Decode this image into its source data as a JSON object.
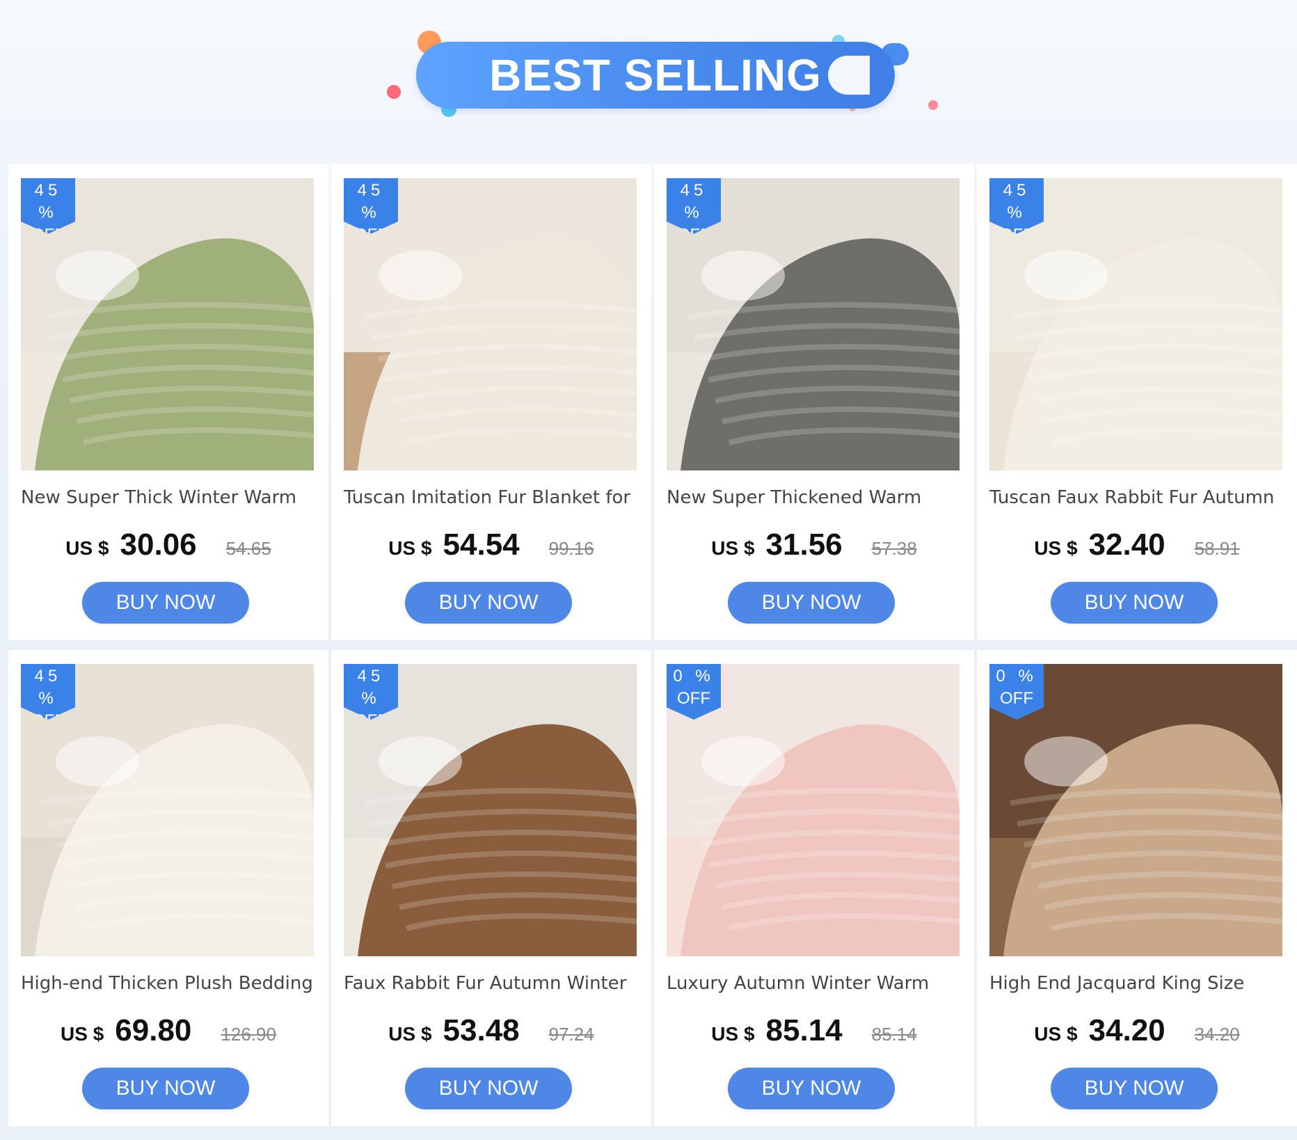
{
  "banner": {
    "title": "BEST SELLING"
  },
  "products": [
    {
      "title": "New Super Thick Winter Warm",
      "discount": "45",
      "off": "OFF",
      "currency": "US $",
      "price": "30.06",
      "old_price": "54.65",
      "button": "BUY NOW",
      "palette": [
        "#e9e4dc",
        "#9fb07a",
        "#f3ece0"
      ]
    },
    {
      "title": "Tuscan Imitation Fur Blanket for",
      "discount": "45",
      "off": "OFF",
      "currency": "US $",
      "price": "54.54",
      "old_price": "99.16",
      "button": "BUY NOW",
      "palette": [
        "#ece6dd",
        "#efe8dc",
        "#a5703a"
      ]
    },
    {
      "title": "New Super Thickened Warm",
      "discount": "45",
      "off": "OFF",
      "currency": "US $",
      "price": "31.56",
      "old_price": "57.38",
      "button": "BUY NOW",
      "palette": [
        "#e4dfd6",
        "#6e6e6a",
        "#efeae2"
      ]
    },
    {
      "title": "Tuscan Faux Rabbit Fur Autumn",
      "discount": "45",
      "off": "OFF",
      "currency": "US $",
      "price": "32.40",
      "old_price": "58.91",
      "button": "BUY NOW",
      "palette": [
        "#efeae0",
        "#f3eee4",
        "#e5dccd"
      ]
    },
    {
      "title": "High-end Thicken Plush Bedding",
      "discount": "45",
      "off": "OFF",
      "currency": "US $",
      "price": "69.80",
      "old_price": "126.90",
      "button": "BUY NOW",
      "palette": [
        "#e7e1d6",
        "#f4f0e8",
        "#d9d2c6"
      ]
    },
    {
      "title": "Faux Rabbit Fur Autumn Winter",
      "discount": "45",
      "off": "OFF",
      "currency": "US $",
      "price": "53.48",
      "old_price": "97.24",
      "button": "BUY NOW",
      "palette": [
        "#e6e2dc",
        "#8a5d3c",
        "#f3eee2"
      ]
    },
    {
      "title": "Luxury Autumn Winter Warm",
      "discount": "0",
      "off": "OFF",
      "currency": "US $",
      "price": "85.14",
      "old_price": "85.14",
      "button": "BUY NOW",
      "palette": [
        "#f1e6e1",
        "#f0c6c1",
        "#f7dcd6"
      ]
    },
    {
      "title": "High End Jacquard King Size",
      "discount": "0",
      "off": "OFF",
      "currency": "US $",
      "price": "34.20",
      "old_price": "34.20",
      "button": "BUY NOW",
      "palette": [
        "#6a4a34",
        "#c9a88a",
        "#a07854"
      ]
    }
  ],
  "colors": {
    "accent": "#3b82e8",
    "button": "#4f87e6",
    "banner": "#4a8cf0"
  },
  "icons": {
    "percent_symbol": "%"
  }
}
